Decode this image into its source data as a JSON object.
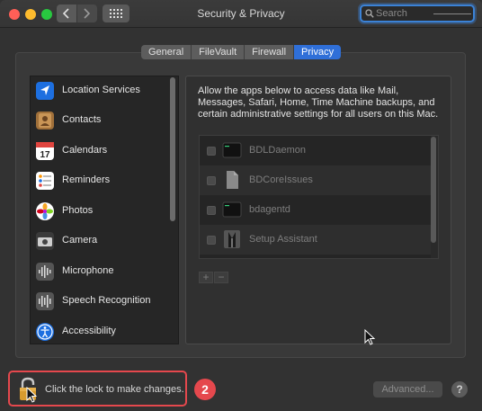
{
  "window": {
    "title": "Security & Privacy"
  },
  "search": {
    "placeholder": "Search"
  },
  "tabs": [
    {
      "label": "General"
    },
    {
      "label": "FileVault"
    },
    {
      "label": "Firewall"
    },
    {
      "label": "Privacy",
      "active": true
    }
  ],
  "sidebar": {
    "items": [
      {
        "label": "Location Services",
        "icon": "location-arrow-icon"
      },
      {
        "label": "Contacts",
        "icon": "contacts-book-icon"
      },
      {
        "label": "Calendars",
        "icon": "calendar-icon",
        "day": "17"
      },
      {
        "label": "Reminders",
        "icon": "reminders-list-icon"
      },
      {
        "label": "Photos",
        "icon": "photos-flower-icon"
      },
      {
        "label": "Camera",
        "icon": "camera-icon"
      },
      {
        "label": "Microphone",
        "icon": "microphone-waveform-icon"
      },
      {
        "label": "Speech Recognition",
        "icon": "speech-waveform-icon"
      },
      {
        "label": "Accessibility",
        "icon": "accessibility-icon"
      }
    ]
  },
  "privacy": {
    "description": "Allow the apps below to access data like Mail, Messages, Safari, Home, Time Machine backups, and certain administrative settings for all users on this Mac.",
    "apps": [
      {
        "name": "BDLDaemon",
        "icon": "terminal-exec-icon",
        "checked": false
      },
      {
        "name": "BDCoreIssues",
        "icon": "document-icon",
        "checked": false
      },
      {
        "name": "bdagentd",
        "icon": "terminal-exec-icon",
        "checked": false
      },
      {
        "name": "Setup Assistant",
        "icon": "setup-assistant-tuxedo-icon",
        "checked": false
      }
    ],
    "add_label": "+",
    "remove_label": "−"
  },
  "footer": {
    "lock_text": "Click the lock to make changes.",
    "step_badge": "2",
    "advanced_label": "Advanced...",
    "help_label": "?"
  },
  "colors": {
    "accent": "#2f6fd8",
    "highlight_red": "#e5484d",
    "window_bg": "#323232"
  }
}
